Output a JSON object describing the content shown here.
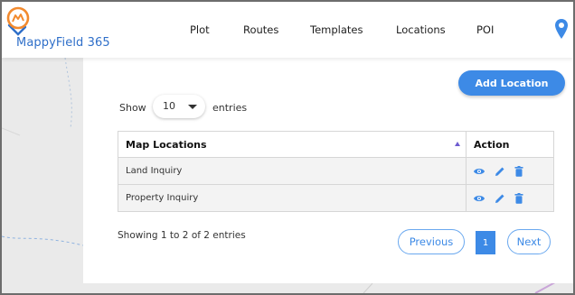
{
  "app": {
    "name": "MappyField 365"
  },
  "nav": {
    "items": [
      "Plot",
      "Routes",
      "Templates",
      "Locations",
      "POI"
    ]
  },
  "toolbar": {
    "add_label": "Add Location"
  },
  "length": {
    "show": "Show",
    "value": "10",
    "entries": "entries"
  },
  "table": {
    "headers": [
      "Map Locations",
      "Action"
    ],
    "rows": [
      {
        "name": "Land Inquiry",
        "actions": [
          "view-icon",
          "edit-icon",
          "delete-icon"
        ]
      },
      {
        "name": "Property Inquiry",
        "actions": [
          "view-icon",
          "edit-icon",
          "delete-icon"
        ]
      }
    ]
  },
  "pagination": {
    "info": "Showing 1 to 2 of 2 entries",
    "previous": "Previous",
    "current": "1",
    "next": "Next"
  },
  "colors": {
    "accent": "#3d8ae6",
    "logo_orange": "#f28a2e",
    "logo_blue": "#2f6fc9"
  }
}
